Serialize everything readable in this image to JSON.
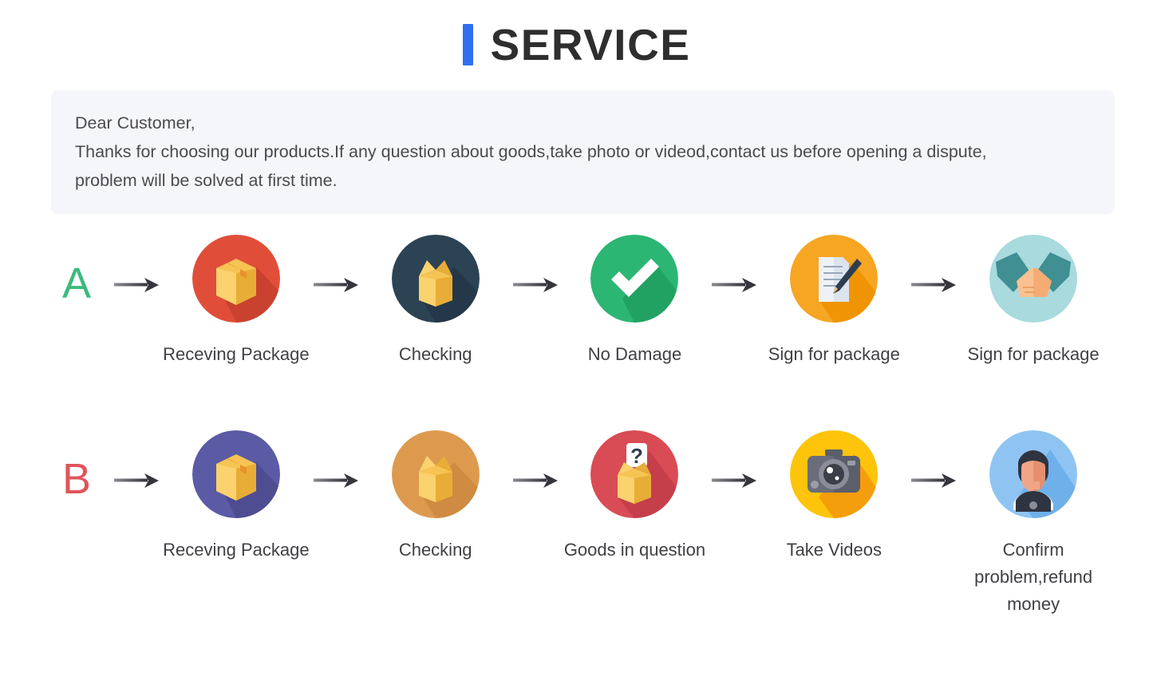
{
  "header": {
    "title": "SERVICE",
    "accent_color": "#2f6ff0"
  },
  "notice": {
    "lines": [
      "Dear Customer,",
      "Thanks for choosing our products.If any question about goods,take photo or videod,contact us before opening a dispute,",
      "problem will be solved at first time."
    ],
    "background_color": "#f5f6f9"
  },
  "flows": [
    {
      "letter": "A",
      "letter_color": "#3cba7c",
      "steps": [
        {
          "label": "Receving Package",
          "icon": "sealed-box-icon",
          "circle_color": "#e04e39"
        },
        {
          "label": "Checking",
          "icon": "open-box-icon",
          "circle_color": "#2c4354"
        },
        {
          "label": "No Damage",
          "icon": "checkmark-icon",
          "circle_color": "#2bb673"
        },
        {
          "label": "Sign for package",
          "icon": "document-sign-icon",
          "circle_color": "#f6a623"
        },
        {
          "label": "Sign for package",
          "icon": "handshake-icon",
          "circle_color": "#a8dade"
        }
      ]
    },
    {
      "letter": "B",
      "letter_color": "#e0555b",
      "steps": [
        {
          "label": "Receving Package",
          "icon": "sealed-box-icon",
          "circle_color": "#5b5aa5"
        },
        {
          "label": "Checking",
          "icon": "open-box-icon",
          "circle_color": "#dd9a4f"
        },
        {
          "label": "Goods in question",
          "icon": "question-box-icon",
          "circle_color": "#d94b55"
        },
        {
          "label": "Take Videos",
          "icon": "camera-icon",
          "circle_color": "#fdc40b"
        },
        {
          "label": "Confirm  problem,refund money",
          "icon": "support-agent-icon",
          "circle_color": "#8fc4f2"
        }
      ]
    }
  ],
  "arrow": {
    "icon": "arrow-right-icon",
    "color": "#3f3f46"
  }
}
